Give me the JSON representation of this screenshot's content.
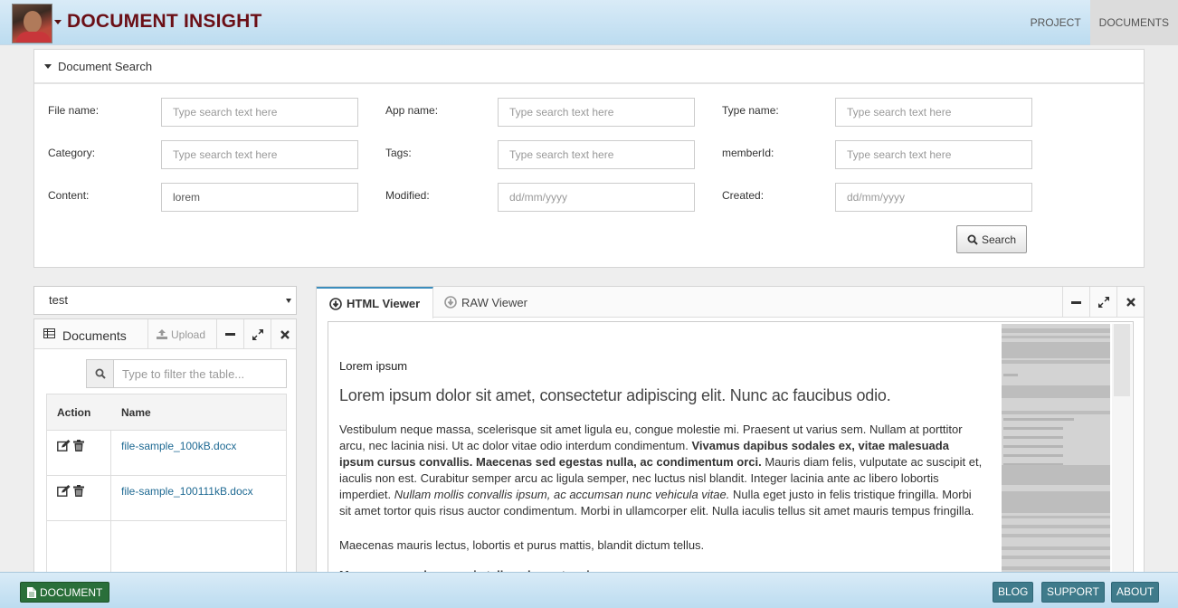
{
  "app": {
    "title": "DOCUMENT INSIGHT"
  },
  "nav": {
    "items": [
      "PROJECT",
      "DOCUMENTS"
    ],
    "active": "DOCUMENTS"
  },
  "search": {
    "title": "Document Search",
    "fields": {
      "file_name": {
        "label": "File name:",
        "placeholder": "Type search text here",
        "value": ""
      },
      "app_name": {
        "label": "App name:",
        "placeholder": "Type search text here",
        "value": ""
      },
      "type_name": {
        "label": "Type name:",
        "placeholder": "Type search text here",
        "value": ""
      },
      "category": {
        "label": "Category:",
        "placeholder": "Type search text here",
        "value": ""
      },
      "tags": {
        "label": "Tags:",
        "placeholder": "Type search text here",
        "value": ""
      },
      "member_id": {
        "label": "memberId:",
        "placeholder": "Type search text here",
        "value": ""
      },
      "content": {
        "label": "Content:",
        "placeholder": "Type search text here",
        "value": "lorem"
      },
      "modified": {
        "label": "Modified:",
        "placeholder": "dd/mm/yyyy",
        "value": ""
      },
      "created": {
        "label": "Created:",
        "placeholder": "dd/mm/yyyy",
        "value": ""
      }
    },
    "button_label": "Search"
  },
  "project_select": {
    "value": "test"
  },
  "documents": {
    "title": "Documents",
    "upload_label": "Upload",
    "filter_placeholder": "Type to filter the table...",
    "columns": [
      "Action",
      "Name"
    ],
    "rows": [
      {
        "name": "file-sample_100kB.docx"
      },
      {
        "name": "file-sample_100111kB.docx"
      }
    ]
  },
  "viewer": {
    "tabs": [
      "HTML Viewer",
      "RAW Viewer"
    ],
    "active_tab": "HTML Viewer",
    "content": {
      "subtitle": "Lorem ipsum",
      "lead": "Lorem ipsum dolor sit amet, consectetur adipiscing elit. Nunc ac faucibus odio.",
      "para1_a": "Vestibulum neque massa, scelerisque sit amet ligula eu, congue molestie mi. Praesent ut varius sem. Nullam at porttitor arcu, nec lacinia nisi. Ut ac dolor vitae odio interdum condimentum. ",
      "para1_b": "Vivamus dapibus sodales ex, vitae malesuada ipsum cursus convallis. Maecenas sed egestas nulla, ac condimentum orci.",
      "para1_c": " Mauris diam felis, vulputate ac suscipit et, iaculis non est. Curabitur semper arcu ac ligula semper, nec luctus nisl blandit. Integer lacinia ante ac libero lobortis imperdiet. ",
      "para1_d": "Nullam mollis convallis ipsum, ac accumsan nunc vehicula vitae.",
      "para1_e": " Nulla eget justo in felis tristique fringilla. Morbi sit amet tortor quis risus auctor condimentum. Morbi in ullamcorper elit. Nulla iaculis tellus sit amet mauris tempus fringilla.",
      "para2": "Maecenas mauris lectus, lobortis et purus mattis, blandit dictum tellus.",
      "para3": "Maecenas non lorem quis tellus placerat varius."
    }
  },
  "footer": {
    "document_label": "DOCUMENT",
    "links": [
      "BLOG",
      "SUPPORT",
      "ABOUT"
    ]
  },
  "colors": {
    "brand": "#6b0f16",
    "footer_primary": "#2a6f3a",
    "footer_links": "#3f7b8b",
    "link": "#1f6a93"
  }
}
